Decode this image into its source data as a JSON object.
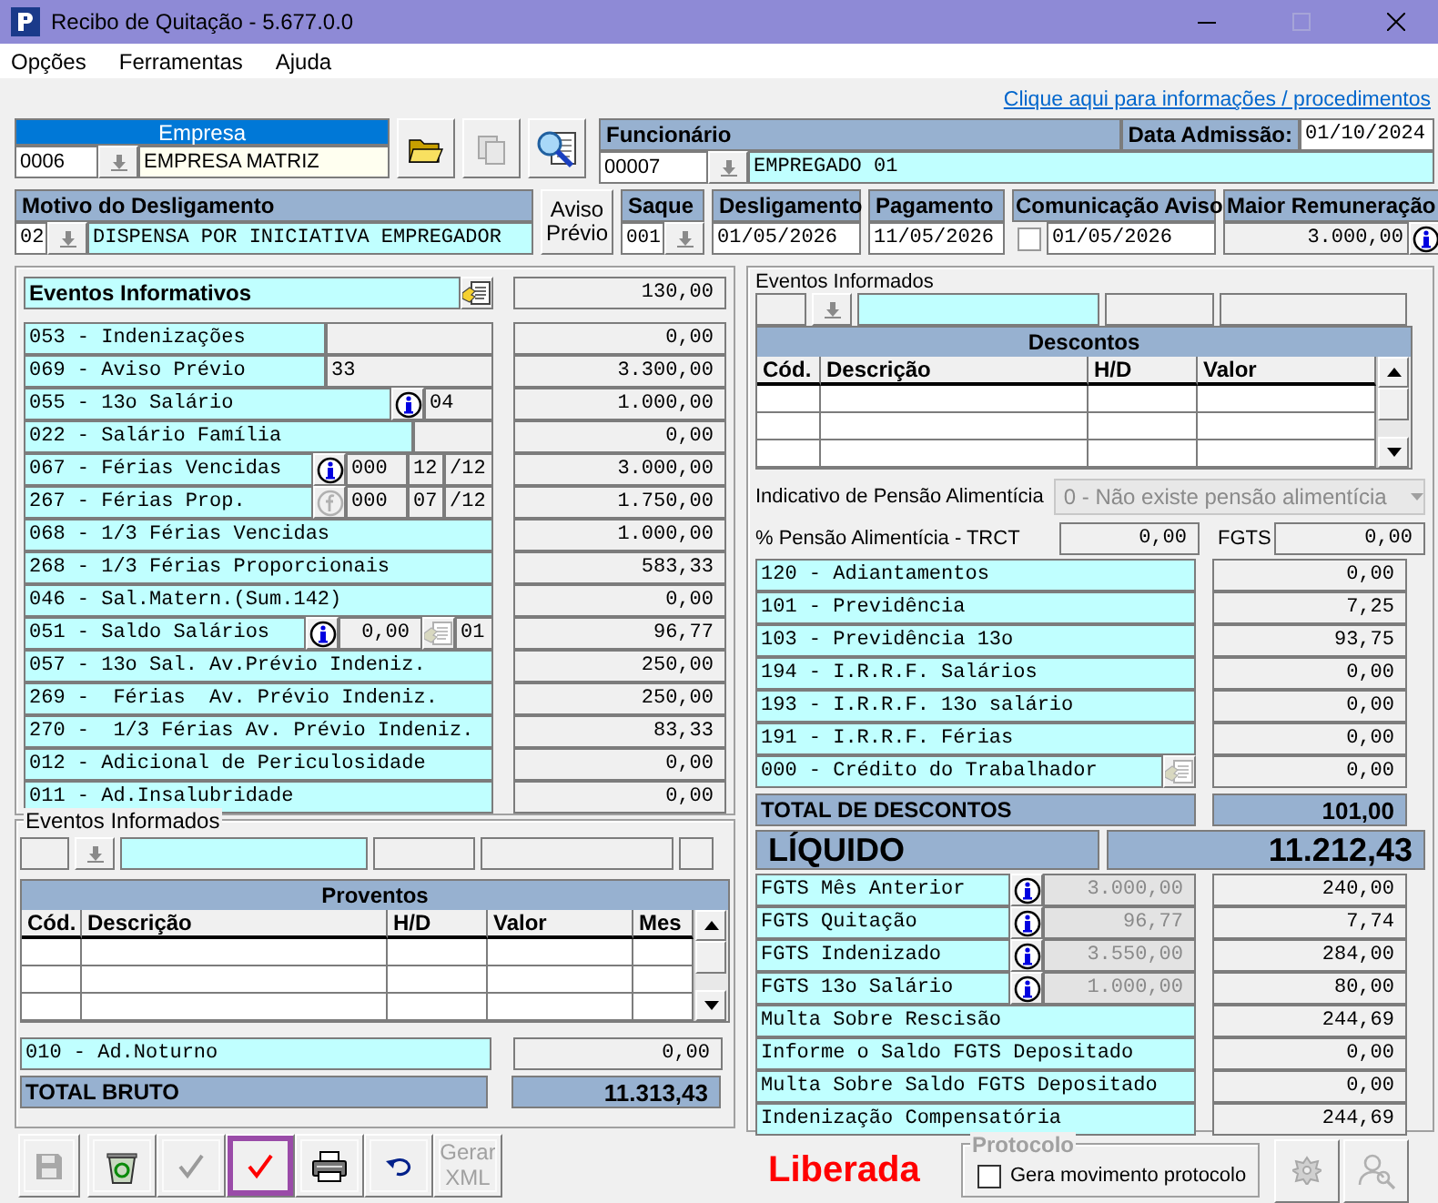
{
  "window": {
    "title": "Recibo de Quitação - 5.677.0.0"
  },
  "menu": [
    "Opções",
    "Ferramentas",
    "Ajuda"
  ],
  "help_link": "Clique aqui para informações / procedimentos",
  "empresa": {
    "label": "Empresa",
    "code": "0006",
    "name": "EMPRESA MATRIZ"
  },
  "funcionario": {
    "label": "Funcionário",
    "code": "00007",
    "name": "EMPREGADO 01",
    "admission_label": "Data Admissão:",
    "admission": "01/10/2024"
  },
  "motivo": {
    "label": "Motivo do Desligamento",
    "code": "02",
    "text": "DISPENSA POR INICIATIVA EMPREGADOR"
  },
  "aviso_button": "Aviso Prévio",
  "saque": {
    "label": "Saque",
    "code": "001"
  },
  "desligamento": {
    "label": "Desligamento",
    "value": "01/05/2026"
  },
  "pagamento": {
    "label": "Pagamento",
    "value": "11/05/2026"
  },
  "comunicacao": {
    "label": "Comunicação Aviso",
    "checked": false,
    "value": "01/05/2026"
  },
  "maior_remuneracao": {
    "label": "Maior Remuneração",
    "value": "3.000,00"
  },
  "eventos_informativos": {
    "title": "Eventos Informativos",
    "total": "130,00",
    "rows": [
      {
        "kind": "field",
        "label": "053 - Indenizações",
        "value": "0,00"
      },
      {
        "kind": "field",
        "label": "069 - Aviso Prévio",
        "note": "33",
        "value": "3.300,00"
      },
      {
        "kind": "info",
        "label": "055 - 13o Salário",
        "note": "04",
        "value": "1.000,00"
      },
      {
        "kind": "short",
        "label": "022 - Salário Família",
        "value": "0,00"
      },
      {
        "kind": "months_info",
        "label": "067 - Férias Vencidas",
        "days": "000",
        "months": "12",
        "of": "/12",
        "value": "3.000,00"
      },
      {
        "kind": "months_formula",
        "label": "267 - Férias Prop.",
        "days": "000",
        "months": "07",
        "of": "/12",
        "value": "1.750,00"
      },
      {
        "kind": "plain",
        "label": "068 - 1/3 Férias Vencidas",
        "value": "1.000,00"
      },
      {
        "kind": "plain",
        "label": "268 - 1/3 Férias Proporcionais",
        "value": "583,33"
      },
      {
        "kind": "plain",
        "label": "046 - Sal.Matern.(Sum.142)",
        "value": "0,00"
      },
      {
        "kind": "saldo",
        "label": "051 - Saldo Salários",
        "amount": "0,00",
        "note": "01",
        "value": "96,77"
      },
      {
        "kind": "plain",
        "label": "057 - 13o Sal. Av.Prévio Indeniz.",
        "value": "250,00"
      },
      {
        "kind": "plain",
        "label": "269 -  Férias  Av. Prévio Indeniz.",
        "value": "250,00"
      },
      {
        "kind": "plain",
        "label": "270 -  1/3 Férias Av. Prévio Indeniz.",
        "value": "83,33"
      },
      {
        "kind": "plain",
        "label": "012 - Adicional de Periculosidade",
        "value": "0,00"
      },
      {
        "kind": "plain",
        "label": "011 - Ad.Insalubridade",
        "value": "0,00"
      }
    ]
  },
  "proventos": {
    "group": "Eventos Informados",
    "title": "Proventos",
    "columns": [
      "Cód.",
      "Descrição",
      "H/D",
      "Valor",
      "Mes"
    ],
    "extra": {
      "label": "010 - Ad.Noturno",
      "value": "0,00"
    },
    "total_label": "TOTAL BRUTO",
    "total": "11.313,43"
  },
  "toolbar": [
    {
      "kind": "save",
      "disabled": true,
      "selected": false
    },
    {
      "kind": "recycle",
      "disabled": false,
      "selected": false
    },
    {
      "kind": "check",
      "disabled": true,
      "selected": false
    },
    {
      "kind": "check",
      "disabled": false,
      "selected": true
    },
    {
      "kind": "print",
      "disabled": false,
      "selected": false
    },
    {
      "kind": "undo",
      "disabled": false,
      "selected": false
    },
    {
      "kind": "text",
      "label": "Gerar XML",
      "disabled": true,
      "selected": false
    }
  ],
  "descontos": {
    "group": "Eventos Informados",
    "title": "Descontos",
    "columns": [
      "Cód.",
      "Descrição",
      "H/D",
      "Valor"
    ],
    "pensao_label": "Indicativo de Pensão Alimentícia",
    "pensao_value": "0 - Não existe pensão alimentícia",
    "pct_label": "% Pensão Alimentícia - TRCT",
    "pct_value": "0,00",
    "fgts_label": "FGTS",
    "fgts_value": "0,00",
    "rows": [
      {
        "kind": "plain",
        "label": "120 - Adiantamentos",
        "value": "0,00"
      },
      {
        "kind": "plain",
        "label": "101 - Previdência",
        "value": "7,25"
      },
      {
        "kind": "plain",
        "label": "103 - Previdência 13o",
        "value": "93,75"
      },
      {
        "kind": "plain",
        "label": "194 - I.R.R.F. Salários",
        "value": "0,00"
      },
      {
        "kind": "plain",
        "label": "193 - I.R.R.F. 13o salário",
        "value": "0,00"
      },
      {
        "kind": "plain",
        "label": "191 - I.R.R.F. Férias",
        "value": "0,00"
      },
      {
        "kind": "button",
        "label": "000 - Crédito do Trabalhador",
        "value": "0,00"
      }
    ],
    "total_label": "TOTAL DE DESCONTOS",
    "total": "101,00",
    "liquido_label": "LÍQUIDO",
    "liquido": "11.212,43",
    "fgts_rows": [
      {
        "kind": "base",
        "label": "FGTS Mês Anterior",
        "base": "3.000,00",
        "value": "240,00"
      },
      {
        "kind": "base",
        "label": "FGTS Quitação",
        "base": "96,77",
        "value": "7,74"
      },
      {
        "kind": "base",
        "label": "FGTS Indenizado",
        "base": "3.550,00",
        "value": "284,00"
      },
      {
        "kind": "base",
        "label": "FGTS 13o Salário",
        "base": "1.000,00",
        "value": "80,00"
      },
      {
        "kind": "plain",
        "label": "Multa Sobre Rescisão",
        "value": "244,69"
      },
      {
        "kind": "plain",
        "label": "Informe o Saldo FGTS Depositado",
        "value": "0,00"
      },
      {
        "kind": "plain",
        "label": "Multa Sobre Saldo FGTS Depositado",
        "value": "0,00"
      },
      {
        "kind": "plain",
        "label": "Indenização Compensatória",
        "value": "244,69"
      }
    ]
  },
  "status": "Liberada",
  "protocolo": {
    "label": "Protocolo",
    "option": "Gera movimento protocolo",
    "checked": false
  }
}
